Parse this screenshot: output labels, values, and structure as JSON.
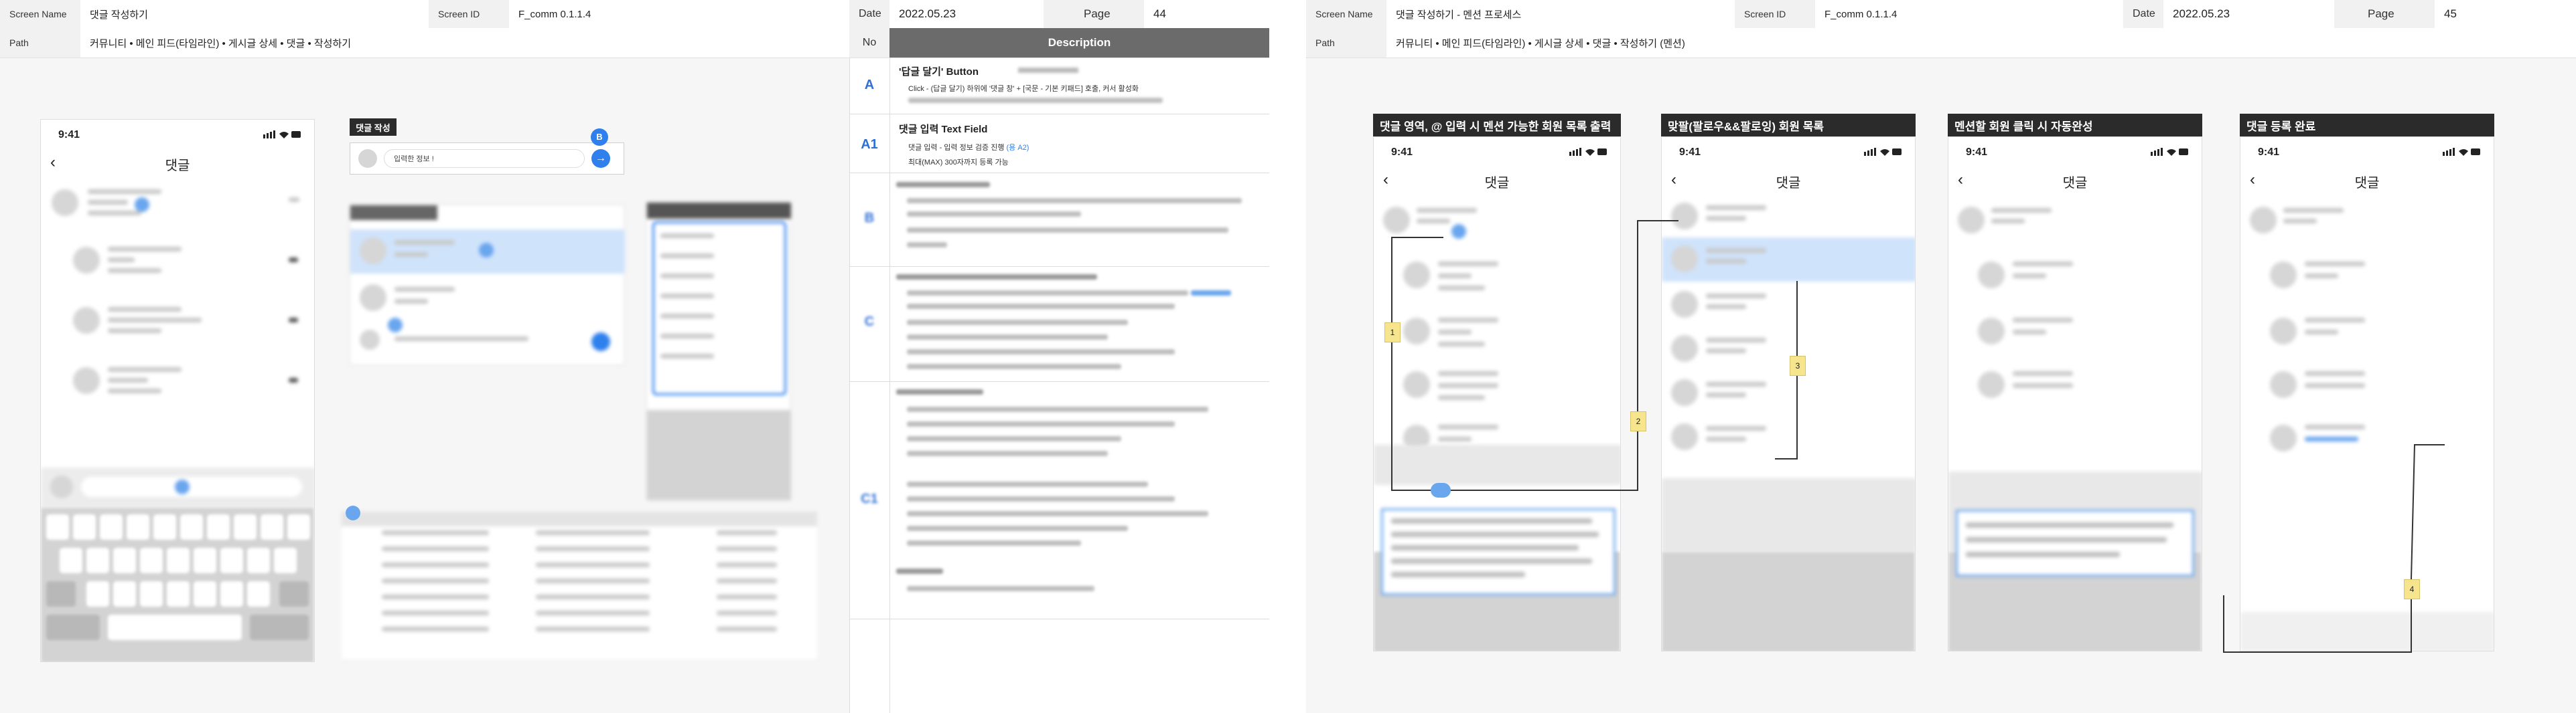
{
  "left_doc": {
    "header": {
      "screen_name_label": "Screen Name",
      "screen_name": "댓글 작성하기",
      "screen_id_label": "Screen ID",
      "screen_id": "F_comm 0.1.1.4",
      "date_label": "Date",
      "date": "2022.05.23",
      "page_label": "Page",
      "page": "44",
      "path_label": "Path",
      "path": "커뮤니티 • 메인 피드(타임라인) • 게시글 상세 • 댓글 • 작성하기"
    },
    "phone": {
      "time": "9:41",
      "title": "댓글"
    },
    "mini_card_title": "댓글 작성",
    "mini_input_placeholder": "입력한 정보 !",
    "badge": "B",
    "table_headers": [
      "No",
      "Description"
    ],
    "items": [
      {
        "no": "A",
        "title": "'답글 달기' Button",
        "lines": [
          "Click - (답글 달기) 하위에 '댓글 창' + [국문 - 기본 키패드] 호출, 커서 활성화"
        ]
      },
      {
        "no": "A1",
        "title": "댓글 입력 Text Field",
        "lines": [
          "댓글 입력 - 입력 정보 검증 진행",
          "(용 A2)",
          "최대(MAX) 300자까지 등록 가능"
        ]
      },
      {
        "no": "B",
        "title": ""
      },
      {
        "no": "C",
        "title": ""
      },
      {
        "no": "C1",
        "title": ""
      }
    ]
  },
  "right_doc": {
    "header": {
      "screen_name_label": "Screen Name",
      "screen_name": "댓글 작성하기 - 멘션 프로세스",
      "screen_id_label": "Screen ID",
      "screen_id": "F_comm 0.1.1.4",
      "date_label": "Date",
      "date": "2022.05.23",
      "page_label": "Page",
      "page": "45",
      "path_label": "Path",
      "path": "커뮤니티 • 메인 피드(타임라인) • 게시글 상세 • 댓글 • 작성하기 (멘션)"
    },
    "steps": [
      {
        "title": "댓글 영역, @ 입력 시 멘션 가능한 회원 목록 출력",
        "time": "9:41",
        "screen_title": "댓글"
      },
      {
        "title": "맞팔(팔로우&&팔로잉) 회원 목록",
        "time": "9:41",
        "screen_title": "댓글"
      },
      {
        "title": "멘션할 회원 클릭 시 자동완성",
        "time": "9:41",
        "screen_title": "댓글"
      },
      {
        "title": "댓글 등록 완료",
        "time": "9:41",
        "screen_title": "댓글"
      }
    ],
    "tags": [
      "1",
      "2",
      "3",
      "4"
    ]
  },
  "colors": {
    "accent": "#2f80ed",
    "highlight": "#cfe3fb",
    "dark_header": "#2b2b2b",
    "note_yellow": "#f6e58d"
  }
}
